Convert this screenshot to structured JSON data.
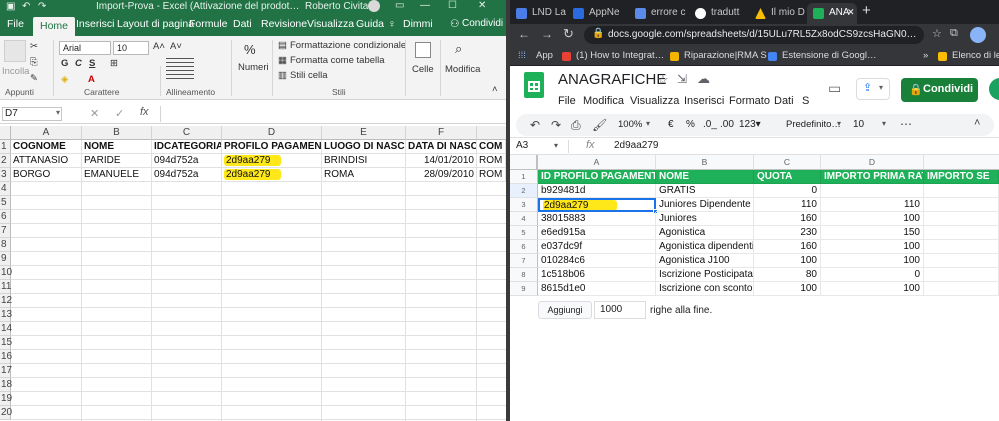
{
  "excel": {
    "qat_title": "Import-Prova  -  Excel (Attivazione del prodot…",
    "user": "Roberto Civita",
    "menu": [
      "File",
      "Home",
      "Inserisci",
      "Layout di pagina",
      "Formule",
      "Dati",
      "Revisione",
      "Visualizza",
      "Guida",
      "Dimmi",
      "Condividi"
    ],
    "ribbon": {
      "paste": "Incolla",
      "font_name": "Arial",
      "font_size": "10",
      "numbers": "Numeri",
      "cond_format": "Formattazione condizionale",
      "table_format": "Formatta come tabella",
      "cell_styles": "Stili cella",
      "cells": "Celle",
      "modify": "Modifica",
      "groups": [
        "Appunti",
        "Carattere",
        "Allineamento",
        "Stili"
      ]
    },
    "name_box": "D7",
    "fx": "fx",
    "columns": [
      "A",
      "B",
      "C",
      "D",
      "E",
      "F"
    ],
    "headers": [
      "COGNOME",
      "NOME",
      "IDCATEGORIA",
      "PROFILO PAGAMENTO",
      "LUOGO DI NASCITA",
      "DATA DI NASCITA",
      "COM"
    ],
    "rows": [
      [
        "ATTANASIO",
        "PARIDE",
        "094d752a",
        "2d9aa279",
        "BRINDISI",
        "14/01/2010",
        "ROM"
      ],
      [
        "BORGO",
        "EMANUELE",
        "094d752a",
        "2d9aa279",
        "ROMA",
        "28/09/2010",
        "ROM"
      ]
    ],
    "row_numbers": [
      "1",
      "2",
      "3",
      "4",
      "5",
      "6",
      "7",
      "8",
      "9",
      "10",
      "11",
      "12",
      "13",
      "14",
      "15",
      "16",
      "17",
      "18",
      "19",
      "20"
    ]
  },
  "chrome": {
    "tabs": [
      {
        "label": "LND La",
        "color": "#4a7de8"
      },
      {
        "label": "AppNe",
        "color": "#2a6be0"
      },
      {
        "label": "errore c",
        "color": "#5b8be8"
      },
      {
        "label": "tradutt",
        "color": "#ffffff"
      },
      {
        "label": "Il mio D",
        "color": "#fbbc04"
      },
      {
        "label": "ANA",
        "color": "#1fb15a"
      }
    ],
    "new_tab": "+",
    "url": "docs.google.com/spreadsheets/d/15ULu7RL5Zx8odCS9zcsHaGN0…",
    "bookmarks": [
      "App",
      "(1) How to Integrat…",
      "Riparazione|RMA S…",
      "Estensione di Googl…",
      "»",
      "Elenco di le"
    ]
  },
  "sheets": {
    "title": "ANAGRAFICHE",
    "menu": [
      "File",
      "Modifica",
      "Visualizza",
      "Inserisci",
      "Formato",
      "Dati",
      "S"
    ],
    "share": "Condividi",
    "zoom": "100%",
    "toolbar_items": [
      "€",
      "%",
      ".0_",
      ".00",
      "123▾",
      "Predefinito…",
      "10"
    ],
    "cell_ref": "A3",
    "formula_value": "2d9aa279",
    "columns": [
      "A",
      "B",
      "C",
      "D"
    ],
    "headers": [
      "ID PROFILO PAGAMENTO",
      "NOME",
      "QUOTA",
      "IMPORTO PRIMA RATA",
      "IMPORTO SE"
    ],
    "rows": [
      [
        "b929481d",
        "GRATIS",
        "0",
        ""
      ],
      [
        "2d9aa279",
        "Juniores Dipendente",
        "110",
        "110"
      ],
      [
        "38015883",
        "Juniores",
        "160",
        "100"
      ],
      [
        "e6ed915a",
        "Agonistica",
        "230",
        "150"
      ],
      [
        "e037dc9f",
        "Agonistica dipendenti",
        "160",
        "100"
      ],
      [
        "010284c6",
        "Agonistica J100",
        "100",
        "100"
      ],
      [
        "1c518b06",
        "Iscrizione Posticipata",
        "80",
        "0"
      ],
      [
        "8615d1e0",
        "Iscrizione con sconto",
        "100",
        "100"
      ]
    ],
    "row_numbers": [
      "1",
      "2",
      "3",
      "4",
      "5",
      "6",
      "7",
      "8",
      "9"
    ],
    "add_button": "Aggiungi",
    "add_count": "1000",
    "add_suffix": "righe alla fine."
  }
}
